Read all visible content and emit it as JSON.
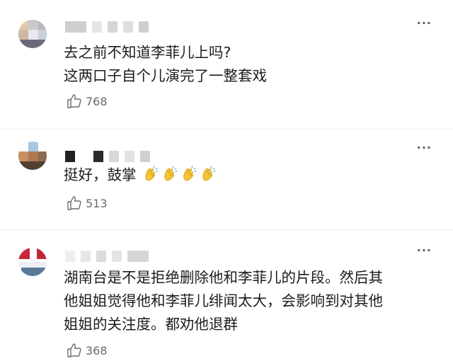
{
  "comments": [
    {
      "text_lines": [
        "去之前不知道李菲儿上吗?",
        "这两口子自个儿演完了一整套戏"
      ],
      "likes": "768",
      "more_label": "···"
    },
    {
      "text_lines": [
        "挺好，鼓掌"
      ],
      "emoji": [
        "clap-emoji",
        "clap-emoji",
        "clap-emoji",
        "clap-emoji"
      ],
      "likes": "513",
      "more_label": "···"
    },
    {
      "text_lines": [
        "湖南台是不是拒绝删除他和李菲儿的片段。然后其",
        "他姐姐觉得他和李菲儿绯闻太大，会影响到对其他",
        "姐姐的关注度。都劝他退群"
      ],
      "likes": "368",
      "more_label": "···"
    }
  ],
  "icons": {
    "like": "thumbs-up-icon",
    "more": "more-dots-icon"
  },
  "colors": {
    "text": "#1c1c1c",
    "meta": "#6b6b6b",
    "divider": "#ebebeb",
    "clap": "#f5c338"
  }
}
